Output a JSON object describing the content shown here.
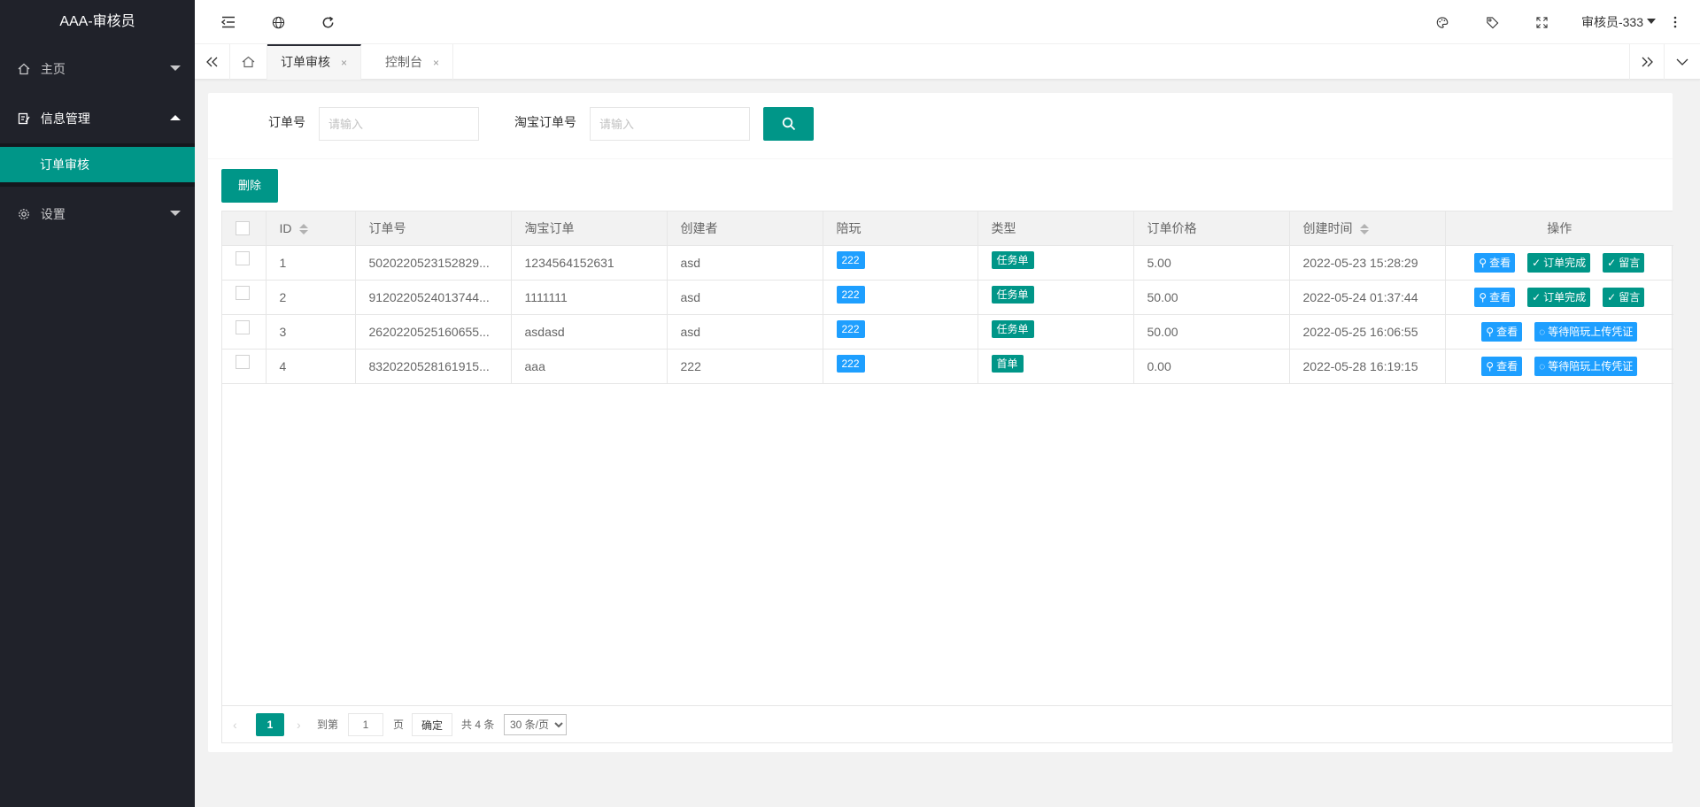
{
  "app": {
    "title": "AAA-审核员"
  },
  "sidebar": {
    "items": [
      {
        "label": "主页"
      },
      {
        "label": "信息管理",
        "children": [
          {
            "label": "订单审核"
          }
        ]
      },
      {
        "label": "设置"
      }
    ]
  },
  "header": {
    "user": "审核员-333",
    "icons": [
      "menu-fold-icon",
      "globe-icon",
      "refresh-icon",
      "theme-icon",
      "tag-icon",
      "fullscreen-icon",
      "more-icon"
    ]
  },
  "tabs": [
    {
      "label": "订单审核",
      "close": "×"
    },
    {
      "label": "控制台",
      "close": "×"
    }
  ],
  "search": {
    "order_no_label": "订单号",
    "order_no_placeholder": "请输入",
    "taobao_label": "淘宝订单号",
    "taobao_placeholder": "请输入"
  },
  "actions": {
    "delete_label": "删除"
  },
  "table": {
    "columns": [
      "ID",
      "订单号",
      "淘宝订单",
      "创建者",
      "陪玩",
      "类型",
      "订单价格",
      "创建时间",
      "操作"
    ],
    "rows": [
      {
        "id": "1",
        "order_no": "5020220523152829...",
        "taobao": "1234564152631",
        "creator": "asd",
        "player": "222",
        "type": "任务单",
        "price": "5.00",
        "created": "2022-05-23 15:28:29",
        "ops": [
          "查看",
          "订单完成",
          "留言"
        ]
      },
      {
        "id": "2",
        "order_no": "9120220524013744...",
        "taobao": "1111111",
        "creator": "asd",
        "player": "222",
        "type": "任务单",
        "price": "50.00",
        "created": "2022-05-24 01:37:44",
        "ops": [
          "查看",
          "订单完成",
          "留言"
        ]
      },
      {
        "id": "3",
        "order_no": "2620220525160655...",
        "taobao": "asdasd",
        "creator": "asd",
        "player": "222",
        "type": "任务单",
        "price": "50.00",
        "created": "2022-05-25 16:06:55",
        "ops": [
          "查看",
          "等待陪玩上传凭证"
        ]
      },
      {
        "id": "4",
        "order_no": "8320220528161915...",
        "taobao": "aaa",
        "creator": "222",
        "player": "222",
        "type": "首单",
        "price": "0.00",
        "created": "2022-05-28 16:19:15",
        "ops": [
          "查看",
          "等待陪玩上传凭证"
        ]
      }
    ]
  },
  "pager": {
    "current": "1",
    "goto_label": "到第",
    "goto_value": "1",
    "page_unit": "页",
    "confirm": "确定",
    "total": "共 4 条",
    "per_page": "30 条/页"
  },
  "colors": {
    "primary": "#009688",
    "blue": "#1e9fff",
    "sidebar": "#20222a"
  }
}
